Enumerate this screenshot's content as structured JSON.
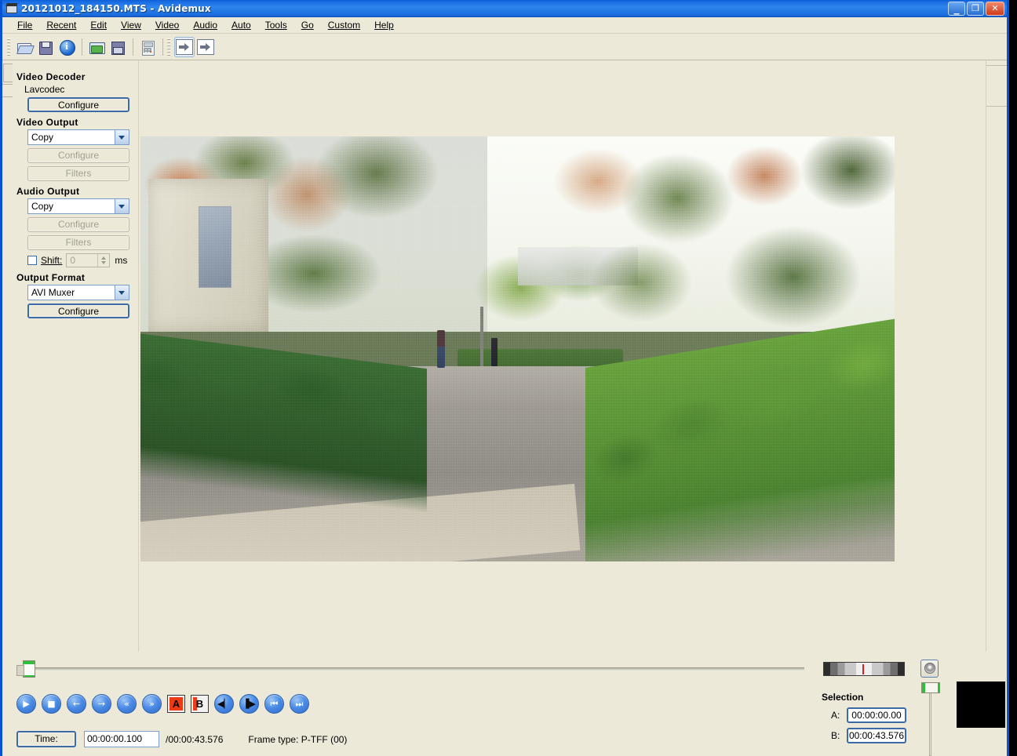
{
  "window": {
    "title": "20121012_184150.MTS - Avidemux",
    "icon": "film-clapper-icon",
    "buttons": {
      "minimize": "_",
      "maximize": "❐",
      "close": "✕"
    }
  },
  "menubar": {
    "items": [
      {
        "label": "File",
        "mnemonic": "F"
      },
      {
        "label": "Recent",
        "mnemonic": "R"
      },
      {
        "label": "Edit",
        "mnemonic": "E"
      },
      {
        "label": "View",
        "mnemonic": "V"
      },
      {
        "label": "Video",
        "mnemonic": "d"
      },
      {
        "label": "Audio",
        "mnemonic": "A"
      },
      {
        "label": "Auto",
        "mnemonic": "u"
      },
      {
        "label": "Tools",
        "mnemonic": "T"
      },
      {
        "label": "Go",
        "mnemonic": "G"
      },
      {
        "label": "Custom",
        "mnemonic": "C"
      },
      {
        "label": "Help",
        "mnemonic": "H"
      }
    ]
  },
  "toolbar": {
    "buttons": [
      {
        "name": "open-file-icon",
        "tip": "Open"
      },
      {
        "name": "save-file-icon",
        "tip": "Save"
      },
      {
        "name": "file-info-icon",
        "tip": "Properties"
      },
      {
        "name": "open-project-icon",
        "tip": "Open project"
      },
      {
        "name": "save-project-icon",
        "tip": "Save project"
      },
      {
        "name": "calculator-icon",
        "tip": "Calculator"
      },
      {
        "name": "append-marker-a-icon",
        "tip": "Set start"
      },
      {
        "name": "append-marker-b-icon",
        "tip": "Set end"
      }
    ]
  },
  "left_panel": {
    "video_decoder": {
      "title": "Video Decoder",
      "codec": "Lavcodec",
      "configure_label": "Configure"
    },
    "video_output": {
      "title": "Video Output",
      "selected": "Copy",
      "configure_label": "Configure",
      "filters_label": "Filters"
    },
    "audio_output": {
      "title": "Audio Output",
      "selected": "Copy",
      "configure_label": "Configure",
      "filters_label": "Filters",
      "shift_label": "Shift:",
      "shift_mnemonic": "S",
      "shift_value": "0",
      "shift_units": "ms",
      "shift_checked": false
    },
    "output_format": {
      "title": "Output Format",
      "selected": "AVI Muxer",
      "configure_label": "Configure"
    }
  },
  "preview": {
    "description": "Autumn park path framed by trimmed hedges with people walking in the distance",
    "timeline_position_percent": 1
  },
  "playback": {
    "buttons": [
      {
        "name": "play-button",
        "glyph": "▶"
      },
      {
        "name": "stop-button",
        "glyph": "■"
      },
      {
        "name": "step-backward-button",
        "glyph": "←"
      },
      {
        "name": "step-forward-button",
        "glyph": "→"
      },
      {
        "name": "rewind-button",
        "glyph": "«"
      },
      {
        "name": "fast-forward-button",
        "glyph": "»"
      }
    ],
    "markers": [
      {
        "name": "set-marker-a-button",
        "label": "A"
      },
      {
        "name": "set-marker-b-button",
        "label": "B"
      }
    ],
    "nav_buttons": [
      {
        "name": "previous-black-frame-button",
        "glyph": "◀▏"
      },
      {
        "name": "next-black-frame-button",
        "glyph": "▐▶"
      },
      {
        "name": "previous-keyframe-button",
        "glyph": "⏮"
      },
      {
        "name": "next-keyframe-button",
        "glyph": "⏭"
      }
    ],
    "time_button_label": "Time:",
    "current_time": "00:00:00.100",
    "total_time": "/00:00:43.576",
    "frame_type": "Frame type: P-TFF (00)"
  },
  "right_panel": {
    "vu_meter_name": "audio-vu-meter",
    "speaker_button_name": "speaker-mute-button",
    "volume_slider_name": "volume-slider",
    "selection_title": "Selection",
    "selection": [
      {
        "label": "A:",
        "value": "00:00:00.00"
      },
      {
        "label": "B:",
        "value": "00:00:43.576"
      }
    ],
    "thumbnail_name": "frame-thumbnail"
  },
  "colors": {
    "title_bar": "#1869e0",
    "window_bg": "#ece9d8",
    "accent_border": "#3c6ba8",
    "marker_red": "#ef3b13",
    "button_blue": "#4a8ae4"
  }
}
